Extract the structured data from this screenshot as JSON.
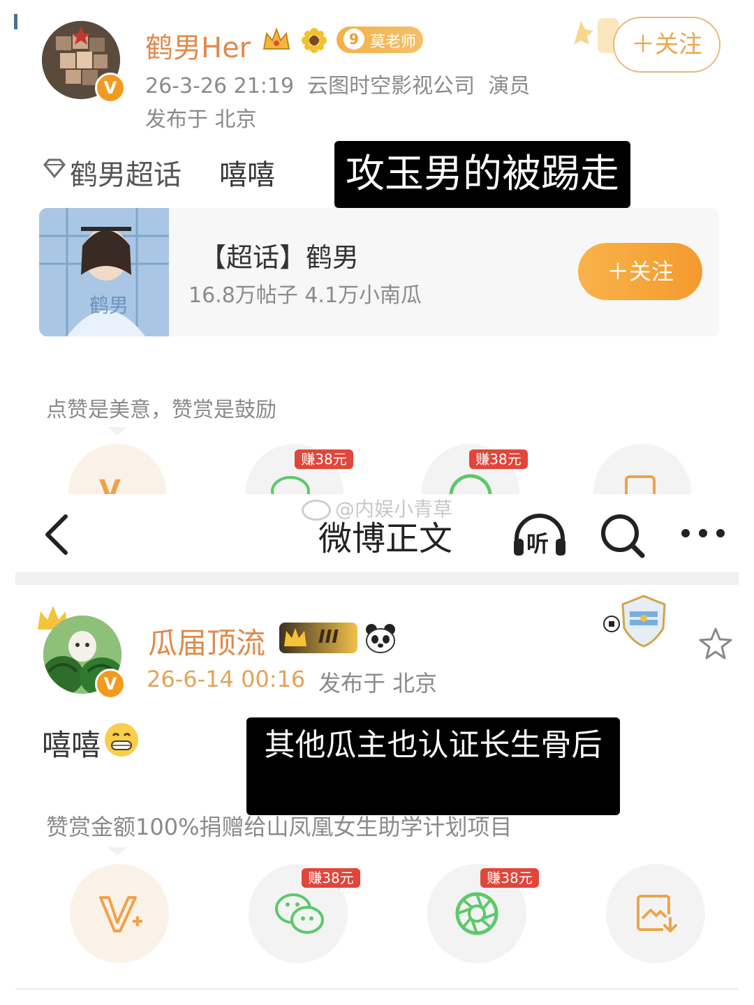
{
  "post1": {
    "username": "鹤男Her",
    "teacher_badge_level": "9",
    "teacher_badge_text": "莫老师",
    "meta_line": "26-3-26 21:19  云图时空影视公司  演员",
    "location": "发布于 北京",
    "follow_label": "＋关注",
    "topic_tag": "鹤男超话",
    "body_text": "嘻嘻",
    "caption": "攻玉男的被踢走",
    "card": {
      "title": "【超话】鹤男",
      "stats": "16.8万帖子 4.1万小南瓜",
      "follow_label": "＋关注",
      "image_text": "鹤男"
    },
    "reward_text": "点赞是美意，赞赏是鼓励",
    "earn_badges": [
      "赚38元",
      "赚38元"
    ]
  },
  "watermark": "@内娱小青草",
  "nav": {
    "back_icon": "chevron-left-icon",
    "title": "微博正文",
    "listen_label": "听",
    "search_icon": "search-icon",
    "more_icon": "more-icon"
  },
  "post2": {
    "username": "瓜届顶流",
    "level_badge": "III",
    "meta_time": "26-6-14 00:16",
    "location": "发布于 北京",
    "body_text": "嘻嘻",
    "caption": "其他瓜主也认证长生骨后",
    "reward_text": "赞赏金额100%捐赠给山凤凰女生助学计划项目",
    "earn_badges": [
      "赚38元",
      "赚38元"
    ]
  },
  "colors": {
    "accent_orange": "#f39a2d",
    "username": "#e08a4c",
    "wechat_green": "#5cc96a",
    "earn_red": "#e0463a"
  }
}
